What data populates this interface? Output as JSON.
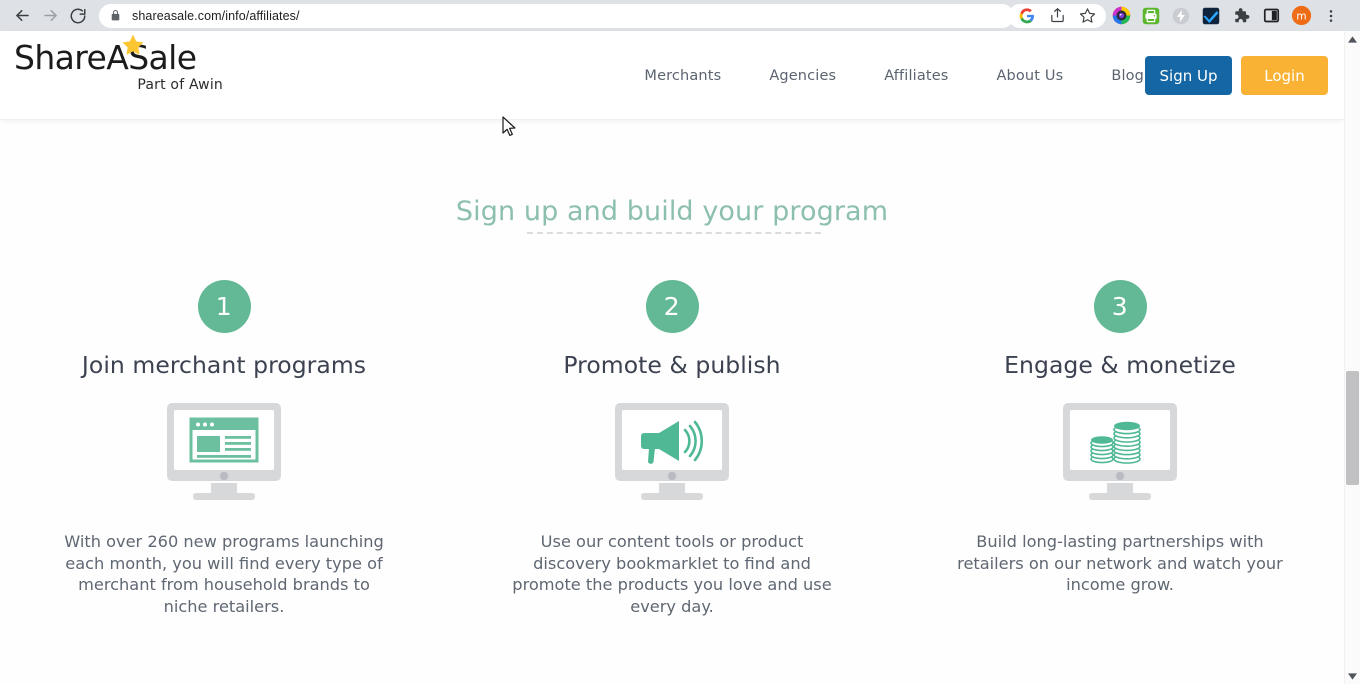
{
  "browser": {
    "back_icon": "back-arrow-icon",
    "forward_icon": "forward-arrow-icon",
    "reload_icon": "reload-icon",
    "lock_icon": "lock-icon",
    "url": "shareasale.com/info/affiliates/",
    "url_domain": "shareasale.com",
    "url_path": "/info/affiliates/",
    "toolbar_icons": [
      {
        "name": "google-search-icon",
        "label": "G"
      },
      {
        "name": "share-icon",
        "label": ""
      },
      {
        "name": "bookmark-star-icon",
        "label": ""
      },
      {
        "name": "extension-colorwheel-icon",
        "label": ""
      },
      {
        "name": "extension-green-printer-icon",
        "label": ""
      },
      {
        "name": "extension-lightning-icon",
        "label": ""
      },
      {
        "name": "extension-blue-check-icon",
        "label": ""
      },
      {
        "name": "extensions-puzzle-icon",
        "label": ""
      },
      {
        "name": "sidepanel-icon",
        "label": ""
      },
      {
        "name": "profile-avatar",
        "label": "m"
      },
      {
        "name": "chrome-menu-icon",
        "label": ""
      }
    ]
  },
  "header": {
    "logo_text": "ShareASale",
    "logo_tagline": "Part of Awin",
    "star_icon": "star-icon",
    "nav": [
      {
        "label": "Merchants"
      },
      {
        "label": "Agencies"
      },
      {
        "label": "Affiliates"
      },
      {
        "label": "About Us"
      },
      {
        "label": "Blog"
      }
    ],
    "signup_label": "Sign Up",
    "login_label": "Login",
    "signup_color": "#1467a4",
    "login_color": "#f9b233"
  },
  "main": {
    "section_title": "Sign up and build your program",
    "accent_color": "#8cbfae",
    "circle_color": "#63b995",
    "steps": [
      {
        "number": "1",
        "title": "Join merchant programs",
        "icon": "monitor-browser-window-icon",
        "text": "With over 260 new programs launching each month, you will find every type of merchant from household brands to niche retailers."
      },
      {
        "number": "2",
        "title": "Promote & publish",
        "icon": "monitor-megaphone-icon",
        "text": "Use our content tools or product discovery bookmarklet to find and promote the products you love and use every day."
      },
      {
        "number": "3",
        "title": "Engage & monetize",
        "icon": "monitor-coin-stacks-icon",
        "text": "Build long-lasting partnerships with retailers on our network and watch your income grow."
      }
    ]
  },
  "scrollbar": {
    "up_icon": "scroll-up-arrow-icon",
    "down_icon": "scroll-down-arrow-icon"
  }
}
